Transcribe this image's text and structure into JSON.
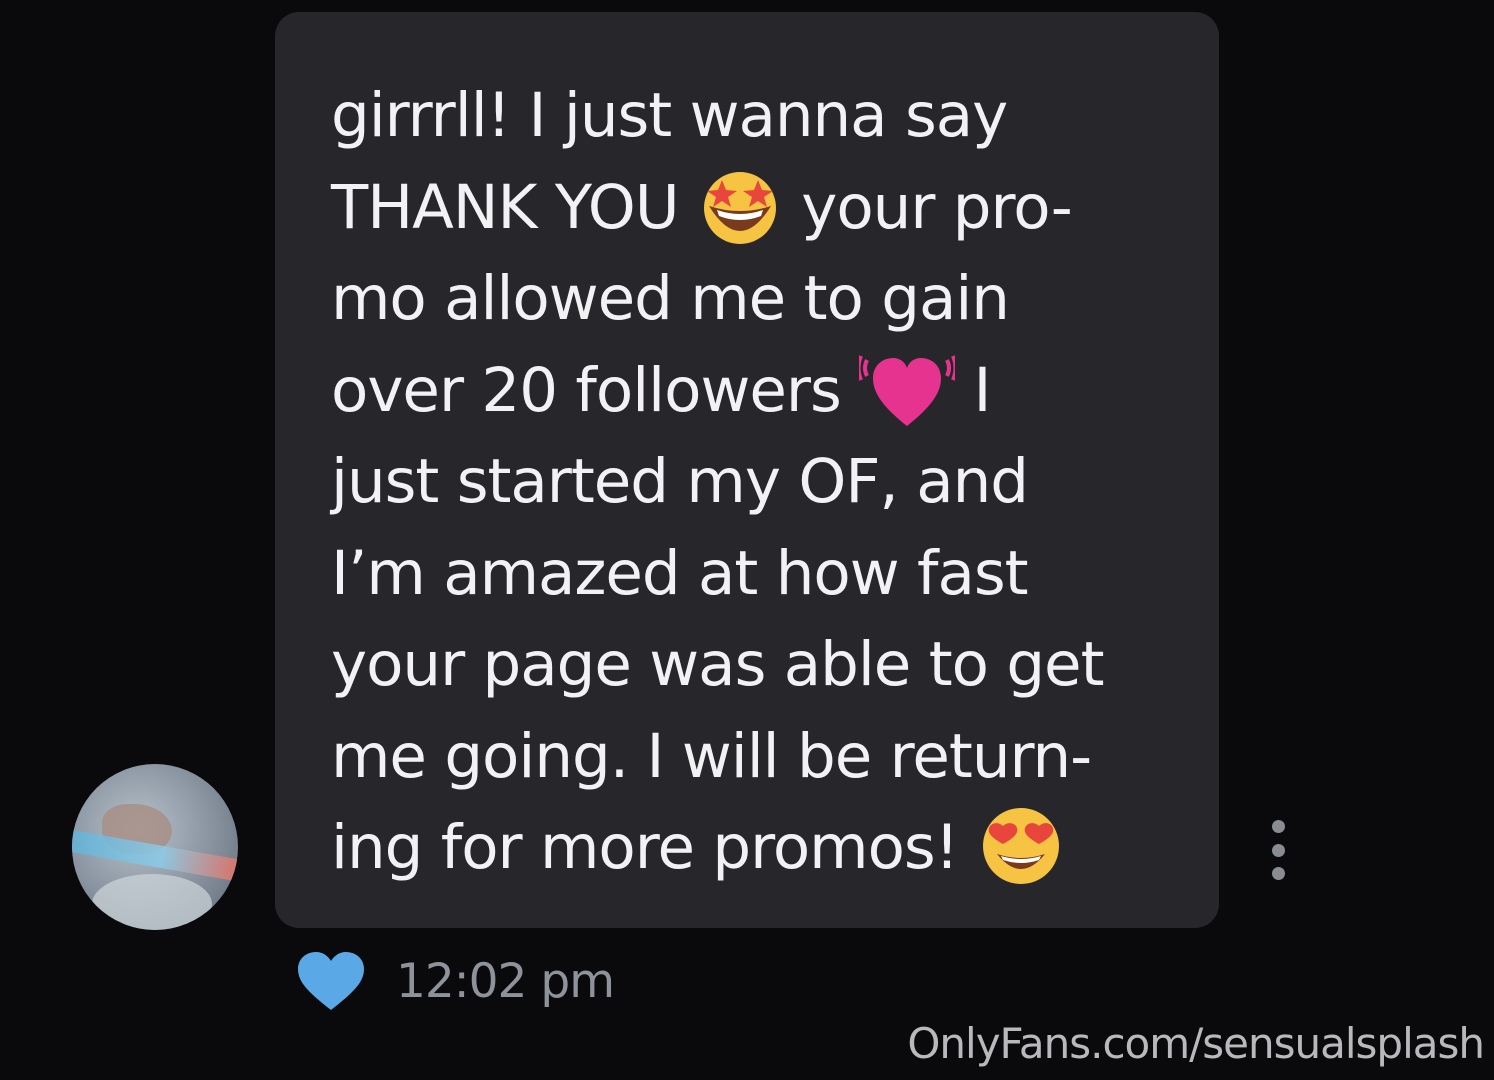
{
  "message": {
    "lines": [
      "girrrll! I just wanna say",
      "THANK YOU",
      "your pro-",
      "mo allowed me to gain",
      "over 20 followers",
      "I",
      "just started my OF, and",
      "I’m amazed at how fast",
      "your page was able to get",
      "me going. I will be return-",
      "ing for more promos!"
    ],
    "emojis": [
      "star-struck-emoji",
      "beating-heart-emoji",
      "heart-eyes-emoji"
    ]
  },
  "meta": {
    "timestamp": "12:02 pm",
    "liked": true,
    "like_color": "#5aa9e6"
  },
  "watermark": "OnlyFans.com/sensualsplash",
  "colors": {
    "background": "#0a0a0c",
    "bubble": "#27272b",
    "text": "#f2f2f4",
    "muted": "#8e929a"
  }
}
